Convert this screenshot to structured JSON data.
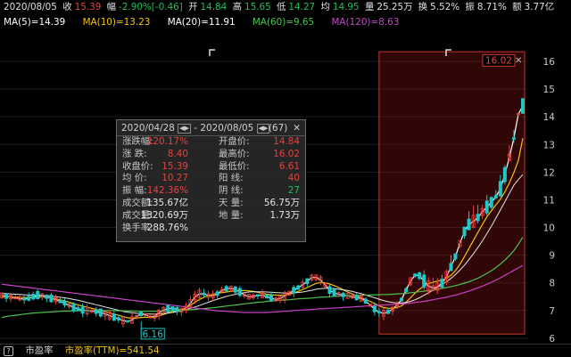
{
  "quote": {
    "date": "2020/08/05",
    "close_label": "收",
    "close": "15.39",
    "change_label": "幅",
    "change": "-2.90%[-0.46]",
    "open_label": "开",
    "open": "14.84",
    "high_label": "高",
    "high": "15.65",
    "low_label": "低",
    "low": "14.27",
    "avg_label": "均",
    "avg": "14.95",
    "volume_label": "量",
    "volume": "25.25万",
    "turnover_label": "换",
    "turnover": "5.52%",
    "amplitude_label": "振",
    "amplitude": "8.71%",
    "amount_label": "额",
    "amount": "3.77亿"
  },
  "ma": {
    "ma5": "MA(5)=14.39",
    "ma10": "MA(10)=13.23",
    "ma20": "MA(20)=11.91",
    "ma60": "MA(60)=9.65",
    "ma120": "MA(120)=8.63"
  },
  "colors": {
    "up": "#e8413c",
    "down": "#1fc6c6",
    "ma5": "#ffffff",
    "ma10": "#f1c40f",
    "ma20": "#ffffff",
    "ma60": "#4ec24e",
    "ma120": "#c843c8",
    "selection": "#c0392b"
  },
  "popup": {
    "range_start": "2020/04/28",
    "range_sep": "-",
    "range_end": "2020/08/05",
    "count": "(67)",
    "close_symbol": "✕",
    "rows": [
      {
        "l1": "涨跌幅:",
        "v1": "120.17%",
        "v1_color": "red",
        "l2": "开盘价:",
        "v2": "14.84",
        "v2_color": "red"
      },
      {
        "l1": "涨    跌:",
        "v1": "8.40",
        "v1_color": "red",
        "l2": "最高价:",
        "v2": "16.02",
        "v2_color": "red"
      },
      {
        "l1": "收盘价:",
        "v1": "15.39",
        "v1_color": "red",
        "l2": "最低价:",
        "v2": "6.61",
        "v2_color": "red"
      },
      {
        "l1": "均    价:",
        "v1": "10.27",
        "v1_color": "red",
        "l2": "阳    线:",
        "v2": "40",
        "v2_color": "red"
      },
      {
        "l1": "振    幅:",
        "v1": "142.36%",
        "v1_color": "red",
        "l2": "阴    线:",
        "v2": "27",
        "v2_color": "green"
      },
      {
        "l1": "成交额:",
        "v1": "135.67亿",
        "v1_color": "white",
        "l2": "天    量:",
        "v2": "56.75万",
        "v2_color": "white"
      },
      {
        "l1": "成交量:",
        "v1": "1320.69万",
        "v1_color": "white",
        "l2": "地    量:",
        "v2": "1.73万",
        "v2_color": "white"
      },
      {
        "l1": "换手率:",
        "v1": "288.76%",
        "v1_color": "white",
        "l2": "",
        "v2": "",
        "v2_color": "white"
      }
    ]
  },
  "bottom": {
    "help_symbol": "?",
    "pe_label": "市盈率",
    "pe_ttm": "市盈率(TTM)=541.54"
  },
  "chart_data": {
    "type": "candlestick",
    "ylim": [
      5.9,
      16.45
    ],
    "y_ticks": [
      "6",
      "7",
      "8",
      "9",
      "10",
      "11",
      "12",
      "13",
      "14",
      "15",
      "16"
    ],
    "max_label": "16.02",
    "min_label": "6.16",
    "series": [
      {
        "name": "MA(5)",
        "values": [
          7.55,
          7.52,
          7.49,
          7.46,
          7.43,
          7.41,
          7.44,
          7.5,
          7.56,
          7.55,
          7.5,
          7.44,
          7.39,
          7.33,
          7.27,
          7.19,
          7.12,
          7.05,
          7.01,
          7.0,
          6.98,
          6.96,
          6.93,
          6.88,
          6.82,
          6.76,
          6.7,
          6.64,
          6.61,
          6.66,
          6.78,
          6.88,
          6.85,
          6.77,
          6.79,
          6.91,
          7.02,
          7.07,
          7.08,
          7.04,
          7.01,
          7.08,
          7.26,
          7.49,
          7.6,
          7.6,
          7.54,
          7.53,
          7.61,
          7.72,
          7.79,
          7.8,
          7.76,
          7.67,
          7.56,
          7.5,
          7.51,
          7.55,
          7.55,
          7.5,
          7.44,
          7.4,
          7.44,
          7.53,
          7.63,
          7.73,
          7.83,
          7.93,
          8.06,
          8.19,
          8.2,
          8.1,
          7.92,
          7.74,
          7.63,
          7.59,
          7.56,
          7.53,
          7.5,
          7.47,
          7.43,
          7.34,
          7.2,
          7.05,
          6.94,
          6.9,
          6.95,
          7.05,
          7.2,
          7.4,
          7.73,
          8.06,
          8.28,
          8.26,
          8.06,
          7.88,
          7.81,
          7.86,
          7.99,
          8.22,
          8.57,
          8.96,
          9.43,
          9.86,
          10.11,
          10.22,
          10.36,
          10.56,
          10.74,
          10.91,
          11.11,
          11.4,
          11.91,
          12.53,
          13.22,
          14.1,
          14.39
        ]
      },
      {
        "name": "MA(10)",
        "values": [
          7.5,
          7.5,
          7.5,
          7.49,
          7.48,
          7.47,
          7.47,
          7.48,
          7.49,
          7.49,
          7.48,
          7.45,
          7.42,
          7.39,
          7.35,
          7.3,
          7.25,
          7.2,
          7.16,
          7.12,
          7.08,
          7.04,
          7.0,
          6.96,
          6.92,
          6.87,
          6.83,
          6.78,
          6.74,
          6.72,
          6.73,
          6.75,
          6.76,
          6.75,
          6.76,
          6.81,
          6.86,
          6.91,
          6.95,
          6.99,
          7.04,
          7.1,
          7.19,
          7.3,
          7.4,
          7.48,
          7.54,
          7.58,
          7.62,
          7.65,
          7.67,
          7.69,
          7.71,
          7.72,
          7.72,
          7.71,
          7.69,
          7.66,
          7.62,
          7.59,
          7.57,
          7.56,
          7.55,
          7.56,
          7.59,
          7.63,
          7.69,
          7.76,
          7.83,
          7.91,
          7.98,
          8.01,
          8.0,
          7.96,
          7.9,
          7.83,
          7.75,
          7.67,
          7.6,
          7.53,
          7.47,
          7.4,
          7.33,
          7.25,
          7.17,
          7.11,
          7.08,
          7.08,
          7.11,
          7.17,
          7.3,
          7.46,
          7.63,
          7.77,
          7.88,
          7.97,
          8.02,
          8.06,
          8.1,
          8.16,
          8.27,
          8.44,
          8.67,
          8.95,
          9.24,
          9.53,
          9.82,
          10.11,
          10.38,
          10.61,
          10.81,
          11.02,
          11.29,
          11.61,
          11.98,
          12.42,
          13.23
        ]
      },
      {
        "name": "MA(20)",
        "values": [
          7.62,
          7.61,
          7.6,
          7.59,
          7.58,
          7.57,
          7.56,
          7.55,
          7.54,
          7.53,
          7.52,
          7.51,
          7.5,
          7.48,
          7.46,
          7.43,
          7.4,
          7.37,
          7.33,
          7.29,
          7.25,
          7.21,
          7.17,
          7.13,
          7.09,
          7.05,
          7.01,
          6.97,
          6.94,
          6.92,
          6.9,
          6.89,
          6.88,
          6.87,
          6.87,
          6.88,
          6.89,
          6.91,
          6.93,
          6.96,
          6.99,
          7.03,
          7.08,
          7.13,
          7.18,
          7.24,
          7.3,
          7.36,
          7.41,
          7.46,
          7.51,
          7.55,
          7.59,
          7.62,
          7.65,
          7.67,
          7.68,
          7.68,
          7.68,
          7.67,
          7.66,
          7.65,
          7.64,
          7.63,
          7.63,
          7.64,
          7.65,
          7.67,
          7.7,
          7.73,
          7.77,
          7.79,
          7.8,
          7.8,
          7.79,
          7.77,
          7.75,
          7.72,
          7.69,
          7.65,
          7.61,
          7.56,
          7.51,
          7.46,
          7.41,
          7.36,
          7.32,
          7.29,
          7.27,
          7.27,
          7.29,
          7.33,
          7.39,
          7.46,
          7.55,
          7.64,
          7.74,
          7.84,
          7.94,
          8.04,
          8.16,
          8.3,
          8.46,
          8.64,
          8.84,
          9.05,
          9.28,
          9.52,
          9.78,
          10.05,
          10.34,
          10.63,
          10.93,
          11.23,
          11.53,
          11.73,
          11.91
        ]
      },
      {
        "name": "MA(60)",
        "values": [
          6.75,
          6.78,
          6.81,
          6.83,
          6.85,
          6.87,
          6.89,
          6.91,
          6.92,
          6.93,
          6.94,
          6.95,
          6.96,
          6.97,
          6.98,
          6.98,
          6.99,
          6.99,
          7.0,
          7.0,
          7.0,
          7.0,
          7.0,
          7.0,
          7.0,
          7.0,
          6.99,
          6.99,
          6.98,
          6.98,
          6.97,
          6.97,
          6.97,
          6.97,
          6.97,
          6.97,
          6.98,
          6.98,
          6.99,
          7.0,
          7.01,
          7.02,
          7.03,
          7.04,
          7.06,
          7.07,
          7.09,
          7.1,
          7.12,
          7.14,
          7.16,
          7.18,
          7.2,
          7.22,
          7.24,
          7.26,
          7.28,
          7.3,
          7.31,
          7.33,
          7.34,
          7.36,
          7.37,
          7.38,
          7.39,
          7.41,
          7.42,
          7.43,
          7.44,
          7.45,
          7.47,
          7.48,
          7.49,
          7.5,
          7.51,
          7.52,
          7.53,
          7.53,
          7.54,
          7.55,
          7.55,
          7.56,
          7.56,
          7.57,
          7.57,
          7.58,
          7.58,
          7.59,
          7.6,
          7.61,
          7.62,
          7.64,
          7.66,
          7.68,
          7.7,
          7.72,
          7.74,
          7.77,
          7.8,
          7.83,
          7.86,
          7.9,
          7.94,
          7.99,
          8.04,
          8.1,
          8.17,
          8.25,
          8.34,
          8.44,
          8.55,
          8.68,
          8.82,
          8.98,
          9.16,
          9.4,
          9.65
        ]
      },
      {
        "name": "MA(120)",
        "values": [
          7.95,
          7.93,
          7.91,
          7.89,
          7.87,
          7.85,
          7.83,
          7.81,
          7.79,
          7.77,
          7.75,
          7.73,
          7.71,
          7.69,
          7.67,
          7.65,
          7.63,
          7.61,
          7.59,
          7.57,
          7.55,
          7.53,
          7.51,
          7.49,
          7.47,
          7.45,
          7.43,
          7.41,
          7.39,
          7.37,
          7.35,
          7.33,
          7.31,
          7.29,
          7.27,
          7.25,
          7.23,
          7.21,
          7.19,
          7.17,
          7.15,
          7.13,
          7.11,
          7.09,
          7.07,
          7.05,
          7.03,
          7.01,
          6.99,
          6.98,
          6.97,
          6.96,
          6.95,
          6.94,
          6.93,
          6.93,
          6.93,
          6.93,
          6.93,
          6.93,
          6.94,
          6.95,
          6.96,
          6.97,
          6.98,
          7.0,
          7.01,
          7.02,
          7.03,
          7.04,
          7.05,
          7.06,
          7.07,
          7.08,
          7.09,
          7.1,
          7.11,
          7.12,
          7.13,
          7.14,
          7.15,
          7.16,
          7.17,
          7.18,
          7.19,
          7.2,
          7.21,
          7.22,
          7.23,
          7.24,
          7.25,
          7.27,
          7.29,
          7.31,
          7.33,
          7.36,
          7.39,
          7.42,
          7.45,
          7.48,
          7.52,
          7.56,
          7.6,
          7.65,
          7.7,
          7.76,
          7.82,
          7.88,
          7.95,
          8.02,
          8.1,
          8.18,
          8.27,
          8.36,
          8.45,
          8.54,
          8.63
        ]
      }
    ]
  }
}
